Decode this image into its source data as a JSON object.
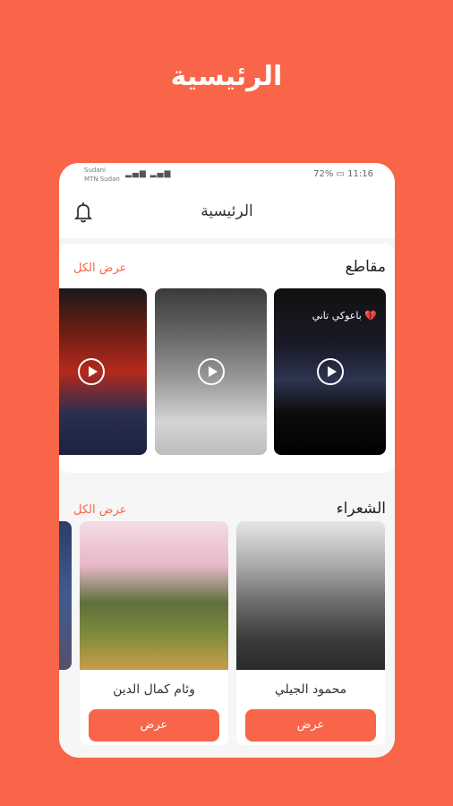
{
  "promo": {
    "title": "الرئيسية"
  },
  "status_bar": {
    "carrier_line1": "Sudani",
    "carrier_line2": "MTN Sudan",
    "battery": "72%",
    "time": "11:16"
  },
  "app_bar": {
    "title": "الرئيسية"
  },
  "clips": {
    "title": "مقاطع",
    "see_all": "عرض الكل",
    "items": [
      {
        "caption": "باعوكي تاني 💔"
      },
      {
        "caption": ""
      },
      {
        "caption": ""
      }
    ]
  },
  "poets": {
    "title": "الشعراء",
    "see_all": "عرض الكل",
    "items": [
      {
        "name": "محمود الجيلي",
        "button": "عرض"
      },
      {
        "name": "وئام كمال الدين",
        "button": "عرض"
      }
    ]
  },
  "colors": {
    "accent": "#F86549"
  }
}
